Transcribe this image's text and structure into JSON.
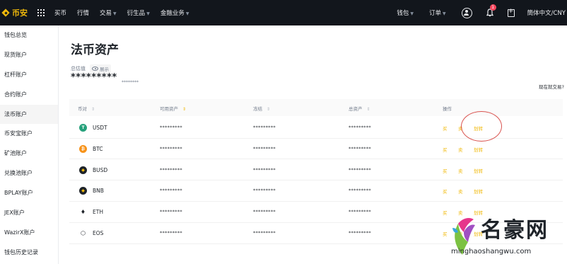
{
  "topbar": {
    "logo_text": "币安",
    "nav": [
      {
        "label": "买币",
        "caret": false
      },
      {
        "label": "行情",
        "caret": false
      },
      {
        "label": "交易",
        "caret": true
      },
      {
        "label": "衍生品",
        "caret": true
      },
      {
        "label": "金融业务",
        "caret": true
      }
    ],
    "wallet": "钱包",
    "orders": "订单",
    "notification_count": "1",
    "language": "簡体中文/CNY"
  },
  "sidebar": {
    "items": [
      "钱包总览",
      "现货账户",
      "杠杆账户",
      "合约账户",
      "法币账户",
      "币安宝账户",
      "矿池账户",
      "兑换池账户",
      "BPLAY账户",
      "JEX账户",
      "WazirX账户",
      "钱包历史记录"
    ],
    "active_index": 4
  },
  "main": {
    "title": "法币资产",
    "estimated_label": "总估值",
    "show_label": "展示",
    "total_masked": "*********",
    "total_sub_masked": "********",
    "find_trade": "现在就交易?",
    "columns": {
      "coin": "币对",
      "available": "可用资产",
      "frozen": "冻结",
      "total": "总资产",
      "action": "操作"
    },
    "rows": [
      {
        "coin": "USDT",
        "color": "#26a17b",
        "symbol": "T",
        "available": "*********",
        "frozen": "*********",
        "total": "*********",
        "buy": "买",
        "sell": "卖",
        "transfer": "划转"
      },
      {
        "coin": "BTC",
        "color": "#f7931a",
        "symbol": "₿",
        "available": "*********",
        "frozen": "*********",
        "total": "*********",
        "buy": "买",
        "sell": "卖",
        "transfer": "划转"
      },
      {
        "coin": "BUSD",
        "color": "#1e2329",
        "symbol": "◆",
        "available": "*********",
        "frozen": "*********",
        "total": "*********",
        "buy": "买",
        "sell": "卖",
        "transfer": "划转"
      },
      {
        "coin": "BNB",
        "color": "#1e2329",
        "symbol": "◆",
        "available": "*********",
        "frozen": "*********",
        "total": "*********",
        "buy": "买",
        "sell": "卖",
        "transfer": "划转"
      },
      {
        "coin": "ETH",
        "color": "#ffffff",
        "symbol": "♦",
        "available": "*********",
        "frozen": "*********",
        "total": "*********",
        "buy": "买",
        "sell": "卖",
        "transfer": "划转"
      },
      {
        "coin": "EOS",
        "color": "#ffffff",
        "symbol": "⬡",
        "available": "*********",
        "frozen": "*********",
        "total": "*********",
        "buy": "买",
        "sell": "卖",
        "transfer": "划转"
      }
    ]
  },
  "watermark": {
    "title": "名豪网",
    "url": "minghaoshangwu.com"
  }
}
